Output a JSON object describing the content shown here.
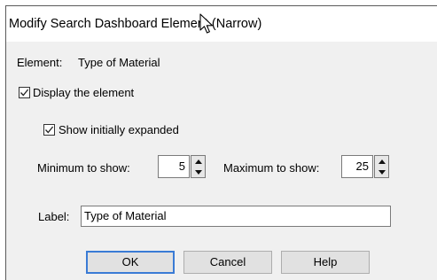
{
  "dialog": {
    "title": "Modify Search Dashboard Element (Narrow)",
    "element_label": "Element:",
    "element_value": "Type of Material",
    "display_checkbox": {
      "label": "Display the element",
      "checked": true
    },
    "expanded_checkbox": {
      "label": "Show initially expanded",
      "checked": true
    },
    "minimum": {
      "label": "Minimum to show:",
      "value": "5"
    },
    "maximum": {
      "label": "Maximum to show:",
      "value": "25"
    },
    "label_field": {
      "label": "Label:",
      "value": "Type of Material"
    },
    "buttons": {
      "ok": "OK",
      "cancel": "Cancel",
      "help": "Help"
    }
  },
  "icons": [
    "checkmark-icon",
    "spin-up-icon",
    "spin-down-icon",
    "mouse-cursor-icon"
  ]
}
